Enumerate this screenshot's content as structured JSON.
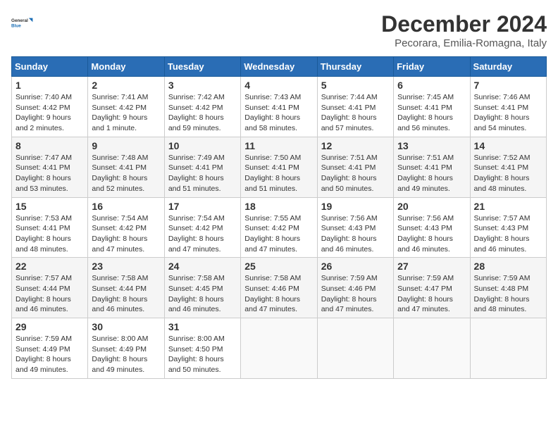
{
  "logo": {
    "line1": "General",
    "line2": "Blue"
  },
  "title": "December 2024",
  "location": "Pecorara, Emilia-Romagna, Italy",
  "header_days": [
    "Sunday",
    "Monday",
    "Tuesday",
    "Wednesday",
    "Thursday",
    "Friday",
    "Saturday"
  ],
  "weeks": [
    [
      {
        "day": "1",
        "sunrise": "Sunrise: 7:40 AM",
        "sunset": "Sunset: 4:42 PM",
        "daylight": "Daylight: 9 hours and 2 minutes."
      },
      {
        "day": "2",
        "sunrise": "Sunrise: 7:41 AM",
        "sunset": "Sunset: 4:42 PM",
        "daylight": "Daylight: 9 hours and 1 minute."
      },
      {
        "day": "3",
        "sunrise": "Sunrise: 7:42 AM",
        "sunset": "Sunset: 4:42 PM",
        "daylight": "Daylight: 8 hours and 59 minutes."
      },
      {
        "day": "4",
        "sunrise": "Sunrise: 7:43 AM",
        "sunset": "Sunset: 4:41 PM",
        "daylight": "Daylight: 8 hours and 58 minutes."
      },
      {
        "day": "5",
        "sunrise": "Sunrise: 7:44 AM",
        "sunset": "Sunset: 4:41 PM",
        "daylight": "Daylight: 8 hours and 57 minutes."
      },
      {
        "day": "6",
        "sunrise": "Sunrise: 7:45 AM",
        "sunset": "Sunset: 4:41 PM",
        "daylight": "Daylight: 8 hours and 56 minutes."
      },
      {
        "day": "7",
        "sunrise": "Sunrise: 7:46 AM",
        "sunset": "Sunset: 4:41 PM",
        "daylight": "Daylight: 8 hours and 54 minutes."
      }
    ],
    [
      {
        "day": "8",
        "sunrise": "Sunrise: 7:47 AM",
        "sunset": "Sunset: 4:41 PM",
        "daylight": "Daylight: 8 hours and 53 minutes."
      },
      {
        "day": "9",
        "sunrise": "Sunrise: 7:48 AM",
        "sunset": "Sunset: 4:41 PM",
        "daylight": "Daylight: 8 hours and 52 minutes."
      },
      {
        "day": "10",
        "sunrise": "Sunrise: 7:49 AM",
        "sunset": "Sunset: 4:41 PM",
        "daylight": "Daylight: 8 hours and 51 minutes."
      },
      {
        "day": "11",
        "sunrise": "Sunrise: 7:50 AM",
        "sunset": "Sunset: 4:41 PM",
        "daylight": "Daylight: 8 hours and 51 minutes."
      },
      {
        "day": "12",
        "sunrise": "Sunrise: 7:51 AM",
        "sunset": "Sunset: 4:41 PM",
        "daylight": "Daylight: 8 hours and 50 minutes."
      },
      {
        "day": "13",
        "sunrise": "Sunrise: 7:51 AM",
        "sunset": "Sunset: 4:41 PM",
        "daylight": "Daylight: 8 hours and 49 minutes."
      },
      {
        "day": "14",
        "sunrise": "Sunrise: 7:52 AM",
        "sunset": "Sunset: 4:41 PM",
        "daylight": "Daylight: 8 hours and 48 minutes."
      }
    ],
    [
      {
        "day": "15",
        "sunrise": "Sunrise: 7:53 AM",
        "sunset": "Sunset: 4:41 PM",
        "daylight": "Daylight: 8 hours and 48 minutes."
      },
      {
        "day": "16",
        "sunrise": "Sunrise: 7:54 AM",
        "sunset": "Sunset: 4:42 PM",
        "daylight": "Daylight: 8 hours and 47 minutes."
      },
      {
        "day": "17",
        "sunrise": "Sunrise: 7:54 AM",
        "sunset": "Sunset: 4:42 PM",
        "daylight": "Daylight: 8 hours and 47 minutes."
      },
      {
        "day": "18",
        "sunrise": "Sunrise: 7:55 AM",
        "sunset": "Sunset: 4:42 PM",
        "daylight": "Daylight: 8 hours and 47 minutes."
      },
      {
        "day": "19",
        "sunrise": "Sunrise: 7:56 AM",
        "sunset": "Sunset: 4:43 PM",
        "daylight": "Daylight: 8 hours and 46 minutes."
      },
      {
        "day": "20",
        "sunrise": "Sunrise: 7:56 AM",
        "sunset": "Sunset: 4:43 PM",
        "daylight": "Daylight: 8 hours and 46 minutes."
      },
      {
        "day": "21",
        "sunrise": "Sunrise: 7:57 AM",
        "sunset": "Sunset: 4:43 PM",
        "daylight": "Daylight: 8 hours and 46 minutes."
      }
    ],
    [
      {
        "day": "22",
        "sunrise": "Sunrise: 7:57 AM",
        "sunset": "Sunset: 4:44 PM",
        "daylight": "Daylight: 8 hours and 46 minutes."
      },
      {
        "day": "23",
        "sunrise": "Sunrise: 7:58 AM",
        "sunset": "Sunset: 4:44 PM",
        "daylight": "Daylight: 8 hours and 46 minutes."
      },
      {
        "day": "24",
        "sunrise": "Sunrise: 7:58 AM",
        "sunset": "Sunset: 4:45 PM",
        "daylight": "Daylight: 8 hours and 46 minutes."
      },
      {
        "day": "25",
        "sunrise": "Sunrise: 7:58 AM",
        "sunset": "Sunset: 4:46 PM",
        "daylight": "Daylight: 8 hours and 47 minutes."
      },
      {
        "day": "26",
        "sunrise": "Sunrise: 7:59 AM",
        "sunset": "Sunset: 4:46 PM",
        "daylight": "Daylight: 8 hours and 47 minutes."
      },
      {
        "day": "27",
        "sunrise": "Sunrise: 7:59 AM",
        "sunset": "Sunset: 4:47 PM",
        "daylight": "Daylight: 8 hours and 47 minutes."
      },
      {
        "day": "28",
        "sunrise": "Sunrise: 7:59 AM",
        "sunset": "Sunset: 4:48 PM",
        "daylight": "Daylight: 8 hours and 48 minutes."
      }
    ],
    [
      {
        "day": "29",
        "sunrise": "Sunrise: 7:59 AM",
        "sunset": "Sunset: 4:49 PM",
        "daylight": "Daylight: 8 hours and 49 minutes."
      },
      {
        "day": "30",
        "sunrise": "Sunrise: 8:00 AM",
        "sunset": "Sunset: 4:49 PM",
        "daylight": "Daylight: 8 hours and 49 minutes."
      },
      {
        "day": "31",
        "sunrise": "Sunrise: 8:00 AM",
        "sunset": "Sunset: 4:50 PM",
        "daylight": "Daylight: 8 hours and 50 minutes."
      },
      null,
      null,
      null,
      null
    ]
  ]
}
